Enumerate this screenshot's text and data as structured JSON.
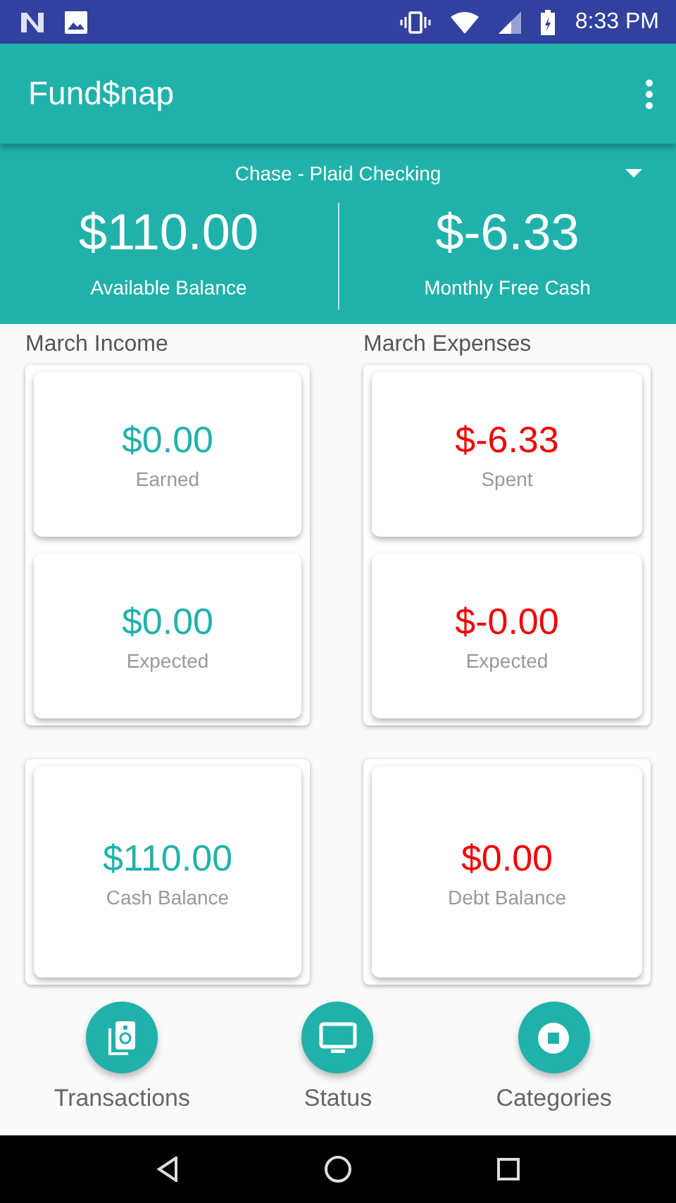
{
  "status_bar": {
    "time": "8:33 PM"
  },
  "app_bar": {
    "title": "Fund$nap"
  },
  "account": {
    "name": "Chase - Plaid Checking",
    "stats": [
      {
        "value": "$110.00",
        "label": "Available Balance"
      },
      {
        "value": "$-6.33",
        "label": "Monthly Free Cash"
      }
    ]
  },
  "groups": [
    {
      "title": "March Income",
      "cards": [
        {
          "amount": "$0.00",
          "label": "Earned",
          "color": "#20b2aa"
        },
        {
          "amount": "$0.00",
          "label": "Expected",
          "color": "#20b2aa"
        }
      ]
    },
    {
      "title": "March Expenses",
      "cards": [
        {
          "amount": "$-6.33",
          "label": "Spent",
          "color": "#f00000"
        },
        {
          "amount": "$-0.00",
          "label": "Expected",
          "color": "#f00000"
        }
      ]
    }
  ],
  "balances": [
    {
      "amount": "$110.00",
      "label": "Cash Balance",
      "color": "#20b2aa"
    },
    {
      "amount": "$0.00",
      "label": "Debt Balance",
      "color": "#f00000"
    }
  ],
  "nav": [
    {
      "label": "Transactions"
    },
    {
      "label": "Status"
    },
    {
      "label": "Categories"
    }
  ]
}
